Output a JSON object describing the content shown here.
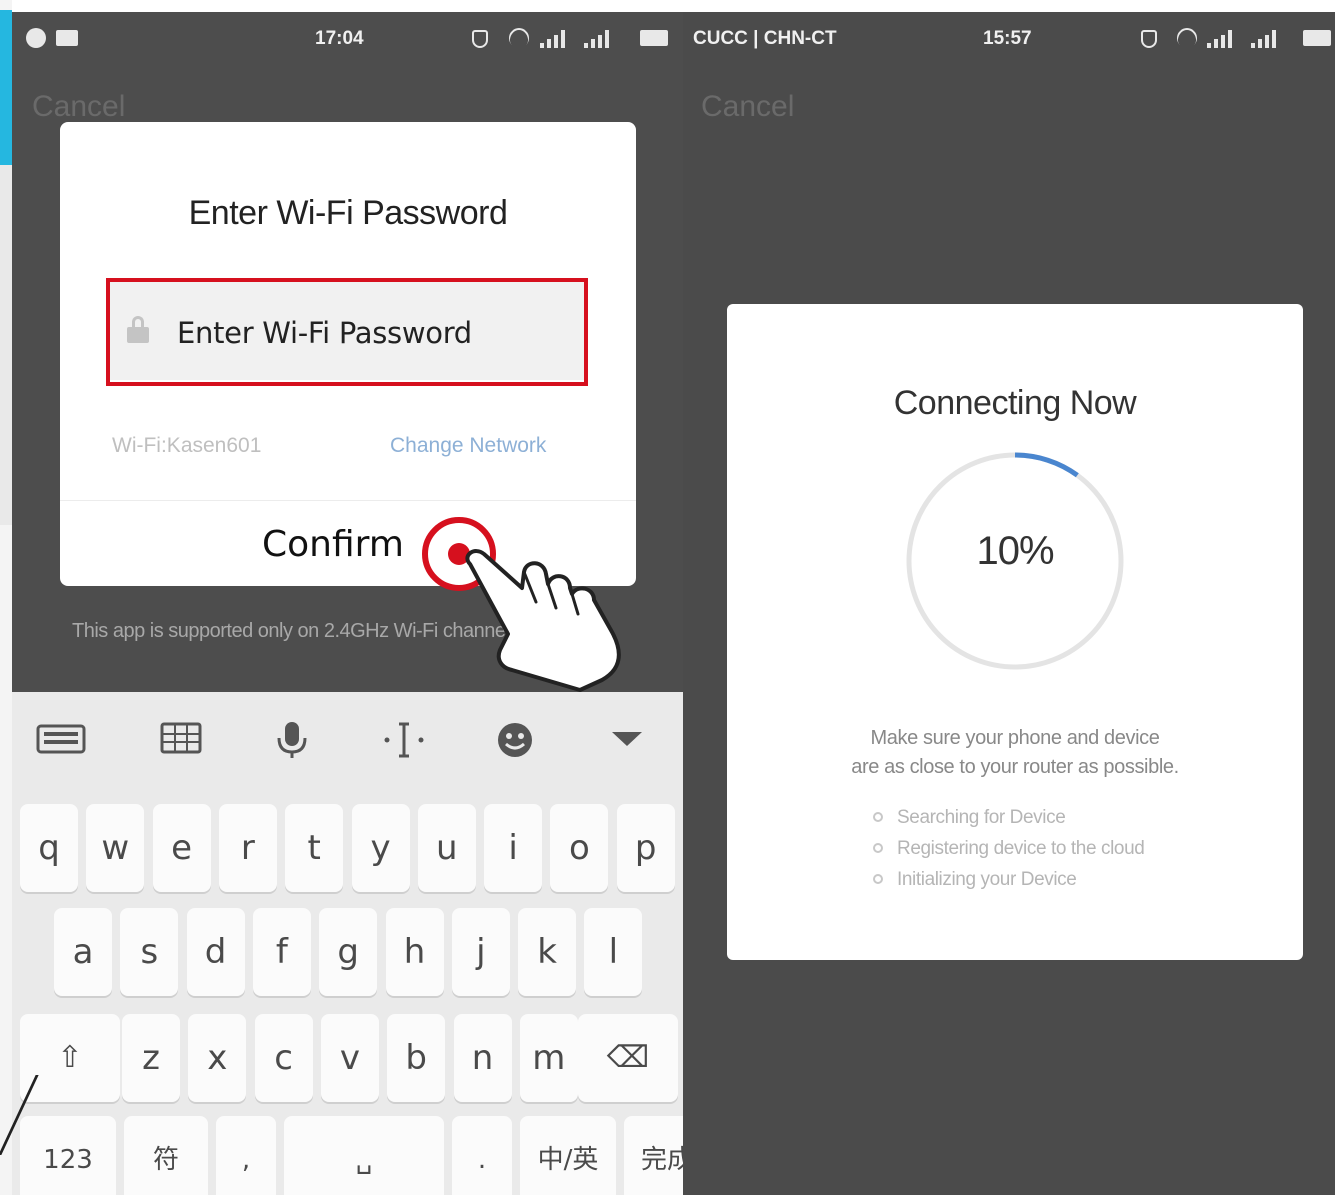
{
  "left_screen": {
    "status_bar": {
      "time": "17:04"
    },
    "cancel_label": "Cancel",
    "dialog": {
      "title": "Enter Wi-Fi Password",
      "password_placeholder": "Enter Wi-Fi Password",
      "wifi_name": "Wi-Fi:Kasen601",
      "change_network_label": "Change Network",
      "confirm_label": "Confirm"
    },
    "band_note": "This app is supported only on 2.4GHz Wi-Fi channel",
    "keyboard": {
      "toolbar": [
        "keyboard-icon",
        "grid-icon",
        "microphone-icon",
        "cursor-icon",
        "emoji-icon",
        "collapse-icon"
      ],
      "row1": [
        "q",
        "w",
        "e",
        "r",
        "t",
        "y",
        "u",
        "i",
        "o",
        "p"
      ],
      "row2": [
        "a",
        "s",
        "d",
        "f",
        "g",
        "h",
        "j",
        "k",
        "l"
      ],
      "row3": [
        "⇧",
        "z",
        "x",
        "c",
        "v",
        "b",
        "n",
        "m",
        "⌫"
      ],
      "row4": [
        "123",
        "符",
        ",",
        "␣",
        ".",
        "中/英",
        "完成"
      ]
    }
  },
  "right_screen": {
    "status_bar": {
      "carrier": "CUCC | CHN-CT",
      "time": "15:57"
    },
    "cancel_label": "Cancel",
    "card": {
      "title": "Connecting Now",
      "progress": 0.1,
      "progress_label": "10%",
      "hint_line1": "Make sure your phone and device",
      "hint_line2": "are as close to your router as possible.",
      "steps": [
        "Searching for Device",
        "Registering device to the cloud",
        "Initializing your Device"
      ]
    }
  },
  "colors": {
    "highlight_red": "#d6101e",
    "progress_blue": "#4a86cf",
    "link_blue": "#8db0d6",
    "overlay_gray": "#4d4d4d"
  }
}
